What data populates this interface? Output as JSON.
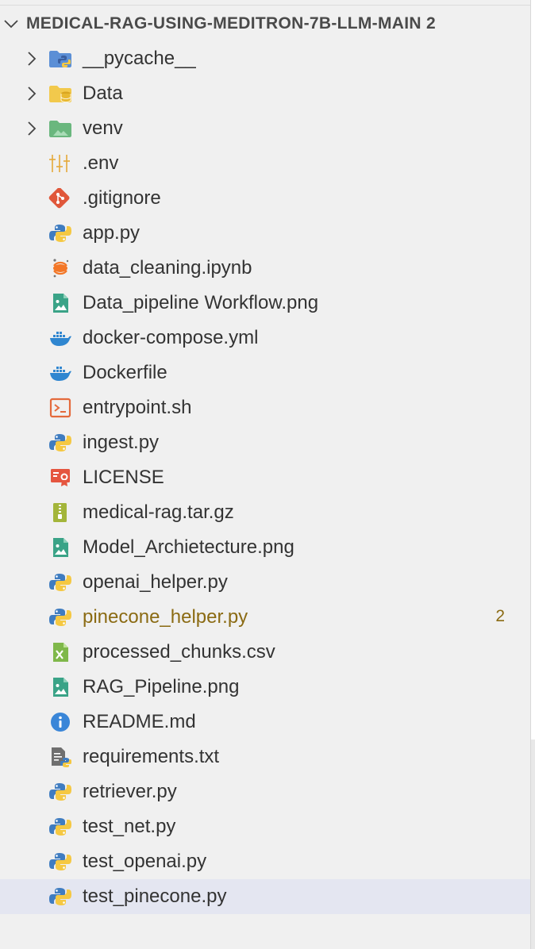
{
  "explorer": {
    "root": {
      "label": "MEDICAL-RAG-USING-MEDITRON-7B-LLM-MAIN 2",
      "icon": "chevron-down-icon",
      "expanded": true
    },
    "items": [
      {
        "name": "__pycache__",
        "kind": "folder",
        "icon": "python-folder-icon",
        "expandable": true
      },
      {
        "name": "Data",
        "kind": "folder",
        "icon": "database-folder-icon",
        "expandable": true
      },
      {
        "name": "venv",
        "kind": "folder",
        "icon": "venv-folder-icon",
        "expandable": true
      },
      {
        "name": ".env",
        "kind": "file",
        "icon": "env-settings-icon"
      },
      {
        "name": ".gitignore",
        "kind": "file",
        "icon": "git-icon"
      },
      {
        "name": "app.py",
        "kind": "file",
        "icon": "python-icon"
      },
      {
        "name": "data_cleaning.ipynb",
        "kind": "file",
        "icon": "jupyter-icon"
      },
      {
        "name": "Data_pipeline Workflow.png",
        "kind": "file",
        "icon": "image-icon"
      },
      {
        "name": "docker-compose.yml",
        "kind": "file",
        "icon": "docker-icon"
      },
      {
        "name": "Dockerfile",
        "kind": "file",
        "icon": "docker-icon"
      },
      {
        "name": "entrypoint.sh",
        "kind": "file",
        "icon": "terminal-icon"
      },
      {
        "name": "ingest.py",
        "kind": "file",
        "icon": "python-icon"
      },
      {
        "name": "LICENSE",
        "kind": "file",
        "icon": "license-icon"
      },
      {
        "name": "medical-rag.tar.gz",
        "kind": "file",
        "icon": "archive-icon"
      },
      {
        "name": "Model_Archietecture.png",
        "kind": "file",
        "icon": "image-icon"
      },
      {
        "name": "openai_helper.py",
        "kind": "file",
        "icon": "python-icon"
      },
      {
        "name": "pinecone_helper.py",
        "kind": "file",
        "icon": "python-icon",
        "badge": "2",
        "warning": true
      },
      {
        "name": "processed_chunks.csv",
        "kind": "file",
        "icon": "csv-icon"
      },
      {
        "name": "RAG_Pipeline.png",
        "kind": "file",
        "icon": "image-icon"
      },
      {
        "name": "README.md",
        "kind": "file",
        "icon": "info-icon"
      },
      {
        "name": "requirements.txt",
        "kind": "file",
        "icon": "requirements-icon"
      },
      {
        "name": "retriever.py",
        "kind": "file",
        "icon": "python-icon"
      },
      {
        "name": "test_net.py",
        "kind": "file",
        "icon": "python-icon"
      },
      {
        "name": "test_openai.py",
        "kind": "file",
        "icon": "python-icon"
      },
      {
        "name": "test_pinecone.py",
        "kind": "file",
        "icon": "python-icon",
        "selected": true
      }
    ]
  },
  "colors": {
    "background": "#f0f0f0",
    "text": "#333333",
    "warning_text": "#8b6b14",
    "selected_row": "#e4e6f1",
    "python_blue": "#3f7cc0",
    "python_yellow": "#f5c842",
    "folder_blue": "#5b8fd6",
    "folder_yellow": "#f2c94c",
    "folder_green": "#6ab77e",
    "git_red": "#e0573a",
    "docker_blue": "#2f86d0",
    "image_teal": "#3aa387",
    "archive_olive": "#a3b53a",
    "license_red": "#e5553f"
  }
}
